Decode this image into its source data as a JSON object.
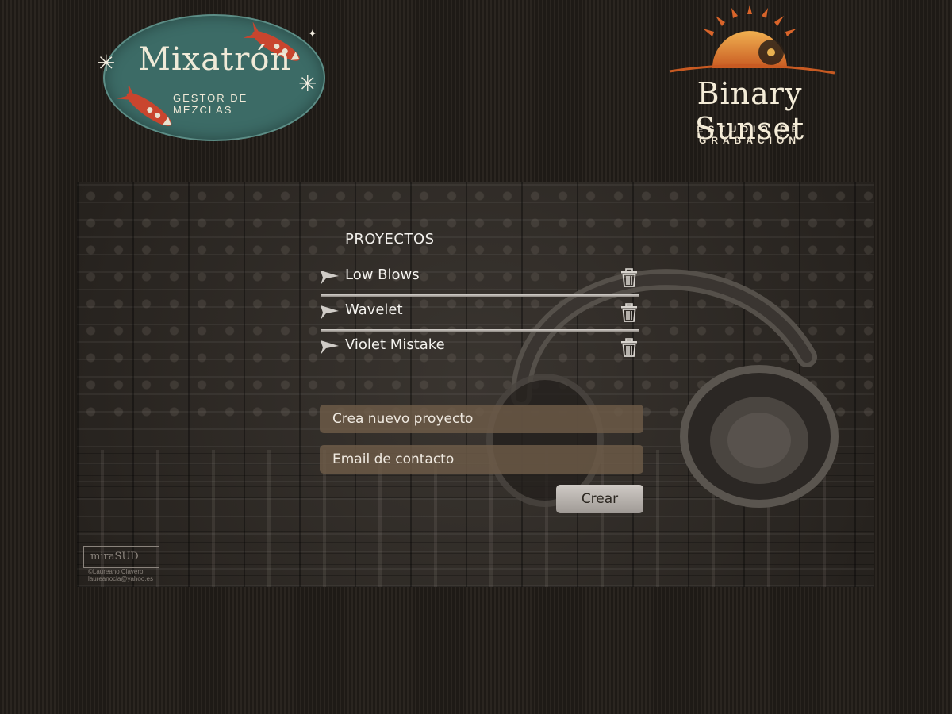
{
  "brand": {
    "app_name": "Mixatrón",
    "app_subtitle": "GESTOR DE MEZCLAS",
    "studio_name": "Binary Sunset",
    "studio_subtitle": "ESTUDIO DE GRABACIÓN"
  },
  "projects": {
    "heading": "PROYECTOS",
    "items": [
      {
        "name": "Low Blows"
      },
      {
        "name": "Wavelet"
      },
      {
        "name": "Violet Mistake"
      }
    ]
  },
  "form": {
    "project_placeholder": "Crea nuevo proyecto",
    "email_placeholder": "Email de contacto",
    "submit_label": "Crear"
  },
  "watermark": {
    "logo_text": "miraSUD",
    "credit": "©Laureano Clavero",
    "email": "laureanocla@yahoo.es"
  },
  "colors": {
    "background": "#221e1a",
    "logo_teal": "#3c6b66",
    "input_fill": "#6e5c48",
    "button_fill": "#bdb8b3",
    "text_light": "#f4f2ee"
  },
  "icons": {
    "project_play": "play-icon",
    "project_delete": "trash-icon"
  }
}
